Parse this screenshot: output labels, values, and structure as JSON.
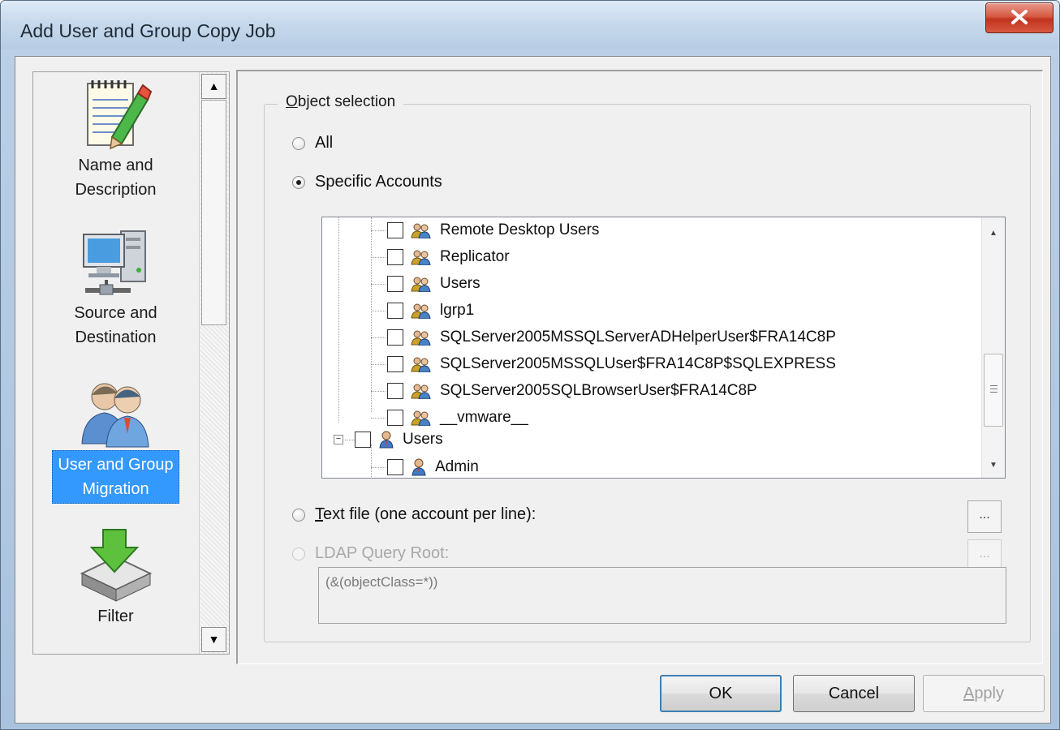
{
  "window": {
    "title": "Add User and Group Copy Job",
    "close_label": "X"
  },
  "nav": {
    "items": [
      {
        "line1": "Name and",
        "line2": "Description",
        "icon": "notepad-pencil-icon"
      },
      {
        "line1": "Source and",
        "line2": "Destination",
        "icon": "computer-network-icon"
      },
      {
        "line1": "User and Group",
        "line2": "Migration",
        "icon": "users-group-icon",
        "selected": true
      },
      {
        "line1": "Filter",
        "line2": "",
        "icon": "filter-download-icon"
      }
    ],
    "scroll_up": "▲",
    "scroll_down": "▼"
  },
  "object_selection": {
    "title": "Object selection",
    "option_all": "All",
    "option_specific": "Specific Accounts",
    "option_textfile": "Text file (one account per line):",
    "option_ldap": "LDAP Query Root:",
    "ldap_query": "(&(objectClass=*))",
    "browse_label": "..."
  },
  "tree": {
    "group_items": [
      "Remote Desktop Users",
      "Replicator",
      "Users",
      "lgrp1",
      "SQLServer2005MSSQLServerADHelperUser$FRA14C8P",
      "SQLServer2005MSSQLUser$FRA14C8P$SQLEXPRESS",
      "SQLServer2005SQLBrowserUser$FRA14C8P",
      "__vmware__"
    ],
    "users_node": "Users",
    "user_items": [
      "Admin"
    ],
    "expander_minus": "−"
  },
  "buttons": {
    "ok": "OK",
    "cancel": "Cancel",
    "apply": "Apply"
  }
}
